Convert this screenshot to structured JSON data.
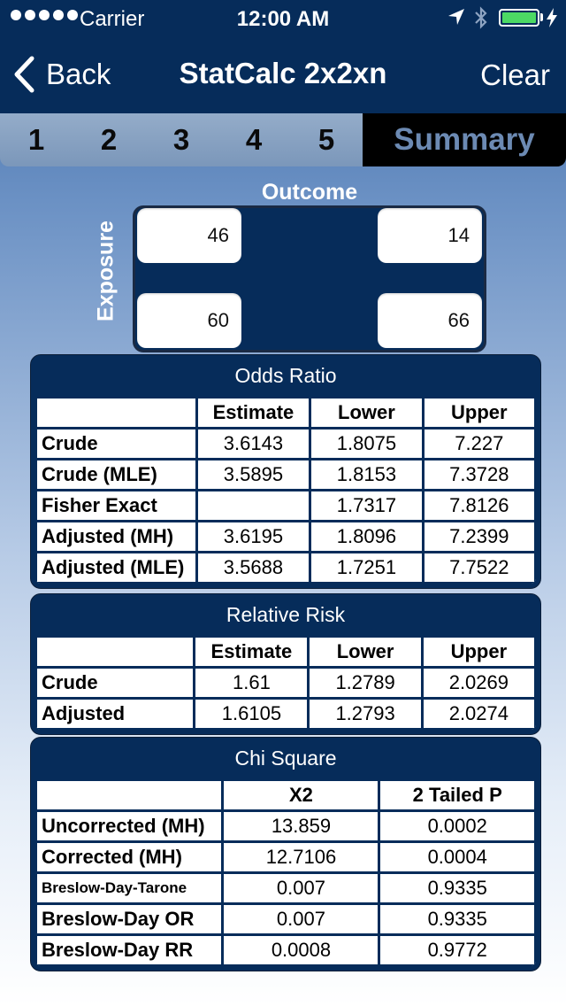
{
  "status_bar": {
    "carrier": "Carrier",
    "time": "12:00 AM",
    "battery_color": "#4cd964"
  },
  "nav": {
    "back_label": "Back",
    "title": "StatCalc 2x2xn",
    "clear_label": "Clear"
  },
  "tabs": {
    "items": [
      "1",
      "2",
      "3",
      "4",
      "5"
    ],
    "summary_label": "Summary",
    "active": "Summary"
  },
  "grid": {
    "outcome_label": "Outcome",
    "exposure_label": "Exposure",
    "a": "46",
    "b": "14",
    "c": "60",
    "d": "66"
  },
  "odds_ratio": {
    "title": "Odds Ratio",
    "headers": [
      "",
      "Estimate",
      "Lower",
      "Upper"
    ],
    "rows": [
      {
        "label": "Crude",
        "estimate": "3.6143",
        "lower": "1.8075",
        "upper": "7.227"
      },
      {
        "label": "Crude (MLE)",
        "estimate": "3.5895",
        "lower": "1.8153",
        "upper": "7.3728"
      },
      {
        "label": "Fisher Exact",
        "estimate": "",
        "lower": "1.7317",
        "upper": "7.8126"
      },
      {
        "label": "Adjusted (MH)",
        "estimate": "3.6195",
        "lower": "1.8096",
        "upper": "7.2399"
      },
      {
        "label": "Adjusted (MLE)",
        "estimate": "3.5688",
        "lower": "1.7251",
        "upper": "7.7522"
      }
    ]
  },
  "relative_risk": {
    "title": "Relative Risk",
    "headers": [
      "",
      "Estimate",
      "Lower",
      "Upper"
    ],
    "rows": [
      {
        "label": "Crude",
        "estimate": "1.61",
        "lower": "1.2789",
        "upper": "2.0269"
      },
      {
        "label": "Adjusted",
        "estimate": "1.6105",
        "lower": "1.2793",
        "upper": "2.0274"
      }
    ]
  },
  "chi_square": {
    "title": "Chi Square",
    "headers": [
      "",
      "X2",
      "2 Tailed P"
    ],
    "rows": [
      {
        "label": "Uncorrected (MH)",
        "x2": "13.859",
        "p": "0.0002"
      },
      {
        "label": "Corrected (MH)",
        "x2": "12.7106",
        "p": "0.0004"
      },
      {
        "label": "Breslow-Day-Tarone",
        "x2": "0.007",
        "p": "0.9335"
      },
      {
        "label": "Breslow-Day OR",
        "x2": "0.007",
        "p": "0.9335"
      },
      {
        "label": "Breslow-Day RR",
        "x2": "0.0008",
        "p": "0.9772"
      }
    ]
  }
}
